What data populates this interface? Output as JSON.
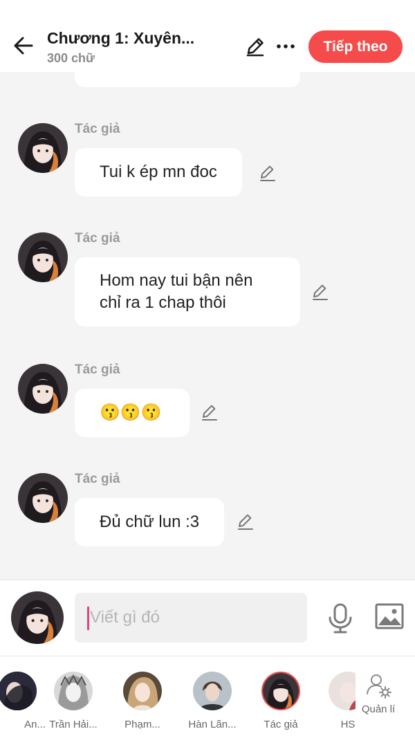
{
  "colors": {
    "accent": "#f54b4b",
    "background": "#f4f4f4",
    "bubble": "#ffffff",
    "caret": "#e8407a"
  },
  "header": {
    "title": "Chương 1: Xuyên...",
    "subtitle": "300 chữ",
    "next_label": "Tiếp theo",
    "back_icon": "arrow-left-icon",
    "edit_icon": "pencil-icon",
    "more_icon": "more-horizontal-icon"
  },
  "messages": [
    {
      "author": "Tác giả",
      "text": "Tui k ép mn đoc"
    },
    {
      "author": "Tác giả",
      "text": "Hom nay tui bận nên chỉ ra 1 chap thôi"
    },
    {
      "author": "Tác giả",
      "text": "😗😗😗"
    },
    {
      "author": "Tác giả",
      "text": "Đủ chữ lun :3"
    }
  ],
  "composer": {
    "placeholder": "Viết gì đó",
    "mic_icon": "microphone-icon",
    "image_icon": "image-icon"
  },
  "cast": [
    {
      "name": "An..."
    },
    {
      "name": "Trần Hải..."
    },
    {
      "name": "Phạm..."
    },
    {
      "name": "Hàn Lãn..."
    },
    {
      "name": "Tác giả",
      "selected": true
    },
    {
      "name": "HS"
    }
  ],
  "manage": {
    "label": "Quản lí",
    "icon": "user-settings-icon"
  }
}
